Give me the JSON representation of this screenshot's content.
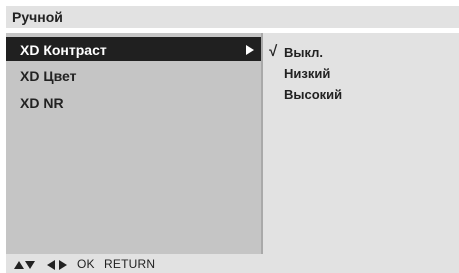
{
  "title": "Ручной",
  "menu": {
    "items": [
      {
        "label": "XD Контраст",
        "selected": true,
        "has_submenu": true
      },
      {
        "label": "XD Цвет",
        "selected": false,
        "has_submenu": false
      },
      {
        "label": "XD NR",
        "selected": false,
        "has_submenu": false
      }
    ]
  },
  "options": {
    "check_mark": "√",
    "items": [
      {
        "label": "Выкл.",
        "checked": true
      },
      {
        "label": "Низкий",
        "checked": false
      },
      {
        "label": "Высокий",
        "checked": false
      }
    ]
  },
  "footer": {
    "nav_icons": [
      "arrow-up-icon",
      "arrow-down-icon",
      "arrow-left-icon",
      "arrow-right-icon"
    ],
    "ok_label": "OK",
    "return_label": "RETURN"
  },
  "colors": {
    "title_bar": "#e2e2e2",
    "menu_panel": "#c5c5c5",
    "options_panel": "#e2e2e2",
    "selected_row": "#202020",
    "text": "#222222",
    "selected_text": "#ffffff"
  }
}
